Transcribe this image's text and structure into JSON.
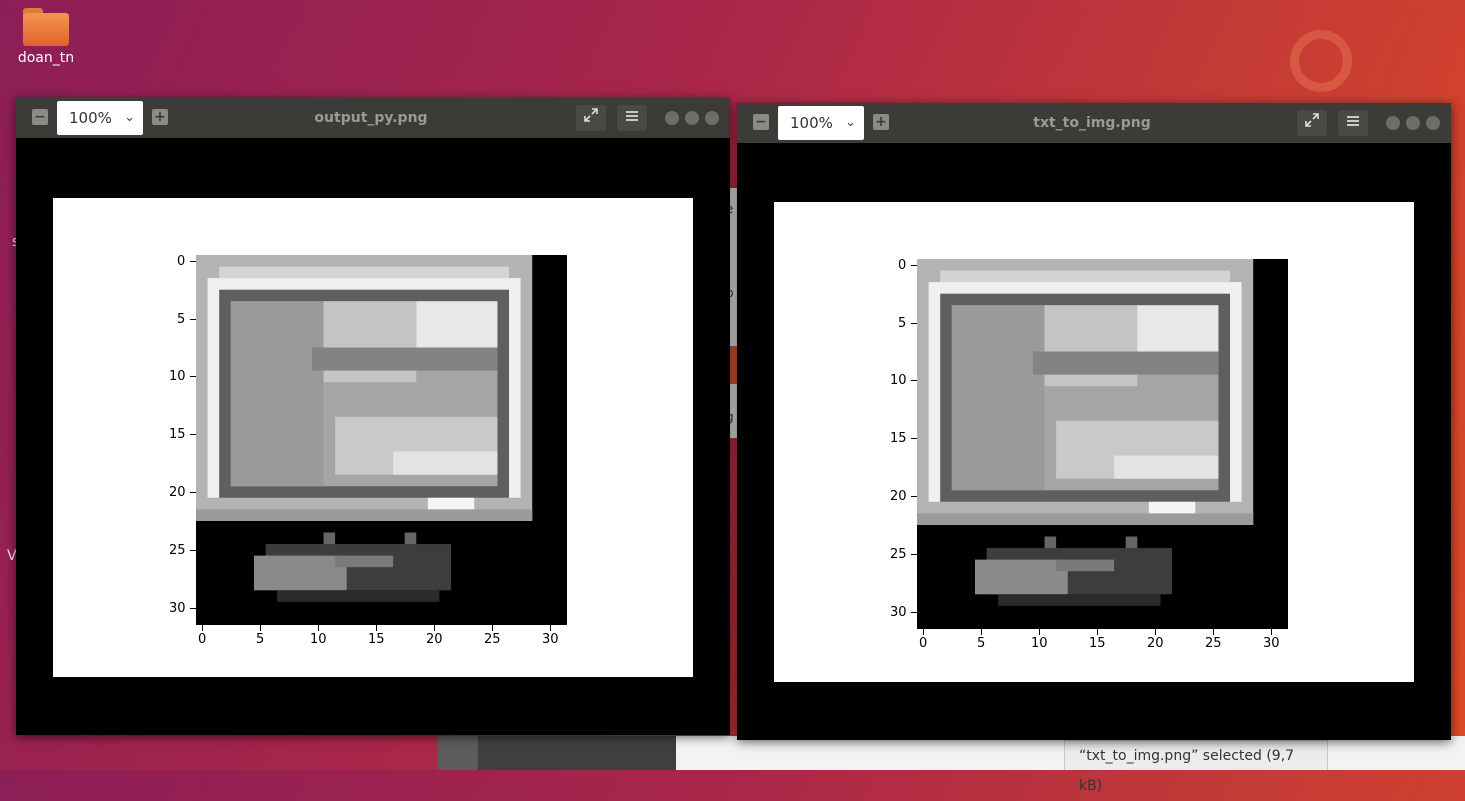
{
  "desktop": {
    "folder_label": "doan_tn",
    "edge_letter_s": "s",
    "edge_letter_v": "V"
  },
  "background": {
    "strip_chars": [
      "e",
      "p",
      "g"
    ]
  },
  "statusbar": {
    "text": "“txt_to_img.png” selected  (9,7 kB)"
  },
  "windows": [
    {
      "title": "output_py.png",
      "zoom": "100%",
      "zoom_out_label": "−",
      "zoom_in_label": "+",
      "fullscreen_icon": "fullscreen-icon",
      "menu_icon": "menu-icon",
      "y_ticks": [
        "0",
        "5",
        "10",
        "15",
        "20",
        "25",
        "30"
      ],
      "x_ticks": [
        "0",
        "5",
        "10",
        "15",
        "20",
        "25",
        "30"
      ]
    },
    {
      "title": "txt_to_img.png",
      "zoom": "100%",
      "zoom_out_label": "−",
      "zoom_in_label": "+",
      "fullscreen_icon": "fullscreen-icon",
      "menu_icon": "menu-icon",
      "y_ticks": [
        "0",
        "5",
        "10",
        "15",
        "20",
        "25",
        "30"
      ],
      "x_ticks": [
        "0",
        "5",
        "10",
        "15",
        "20",
        "25",
        "30"
      ]
    }
  ],
  "colors": {
    "titlebar": "#3c3b37",
    "accent_orange": "#e0622a"
  }
}
